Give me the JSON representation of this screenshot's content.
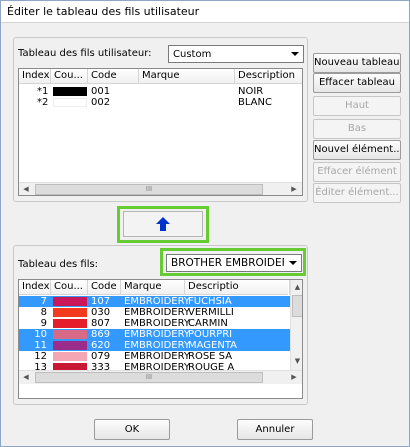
{
  "window": {
    "title": "Éditer le tableau des fils utilisateur"
  },
  "user_table": {
    "label": "Tableau des fils utilisateur:",
    "selected": "Custom",
    "columns": [
      "Index",
      "Cou...",
      "Code",
      "Marque",
      "Description"
    ],
    "rows": [
      {
        "index": "*1",
        "color": "#000000",
        "code": "001",
        "brand": "",
        "description": "NOIR"
      },
      {
        "index": "*2",
        "color": "#ffffff",
        "code": "002",
        "brand": "",
        "description": "BLANC"
      }
    ]
  },
  "side_buttons": {
    "new_table": "Nouveau tableau...",
    "delete_table": "Effacer tableau",
    "up": "Haut",
    "down": "Bas",
    "new_element": "Nouvel élément...",
    "delete_element": "Effacer élément",
    "edit_element": "Éditer élément..."
  },
  "transfer": {
    "icon": "arrow-up-icon",
    "color": "#0033cc"
  },
  "thread_table": {
    "label": "Tableau des fils:",
    "selected": "BROTHER EMBROIDEF",
    "columns": [
      "Index",
      "Cou...",
      "Code",
      "Marque",
      "Descriptio"
    ],
    "rows": [
      {
        "index": "7",
        "color": "#c8175a",
        "code": "107",
        "brand": "EMBROIDERY",
        "description": "FUCHSIA",
        "selected": true
      },
      {
        "index": "8",
        "color": "#f23b1e",
        "code": "030",
        "brand": "EMBROIDERY",
        "description": "VERMILLI",
        "selected": false
      },
      {
        "index": "9",
        "color": "#e41c2b",
        "code": "807",
        "brand": "EMBROIDERY",
        "description": "CARMIN",
        "selected": false
      },
      {
        "index": "10",
        "color": "#d86a86",
        "code": "869",
        "brand": "EMBROIDERY",
        "description": "POURPRI",
        "selected": true
      },
      {
        "index": "11",
        "color": "#9a2d8c",
        "code": "620",
        "brand": "EMBROIDERY",
        "description": "MAGENTA",
        "selected": true
      },
      {
        "index": "12",
        "color": "#f4a6b4",
        "code": "079",
        "brand": "EMBROIDERY",
        "description": "ROSE SA",
        "selected": false
      },
      {
        "index": "13",
        "color": "#c81834",
        "code": "333",
        "brand": "EMBROIDERY",
        "description": "ROUGE A",
        "selected": false
      }
    ]
  },
  "footer": {
    "ok": "OK",
    "cancel": "Annuler"
  },
  "scroll_glyphs": {
    "left": "◀",
    "right": "▶",
    "up": "▲",
    "down": "▼",
    "grip": "III"
  },
  "colors": {
    "selection": "#3399ff",
    "highlight_frame": "#66cc33"
  }
}
